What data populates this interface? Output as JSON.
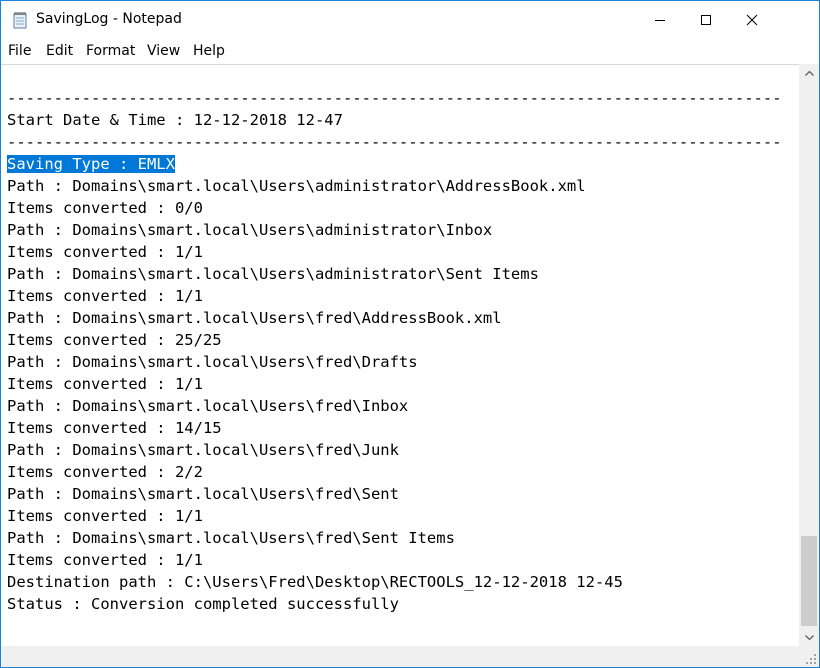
{
  "window": {
    "title": "SavingLog - Notepad",
    "icon": "notepad-icon"
  },
  "menu": {
    "file": "File",
    "edit": "Edit",
    "format": "Format",
    "view": "View",
    "help": "Help"
  },
  "document": {
    "lines": [
      "-----------------------------------------------------------------------------------",
      "Start Date & Time : 12-12-2018 12-47",
      "-----------------------------------------------------------------------------------",
      "Saving Type : EMLX",
      "Path : Domains\\smart.local\\Users\\administrator\\AddressBook.xml",
      "Items converted : 0/0",
      "Path : Domains\\smart.local\\Users\\administrator\\Inbox",
      "Items converted : 1/1",
      "Path : Domains\\smart.local\\Users\\administrator\\Sent Items",
      "Items converted : 1/1",
      "Path : Domains\\smart.local\\Users\\fred\\AddressBook.xml",
      "Items converted : 25/25",
      "Path : Domains\\smart.local\\Users\\fred\\Drafts",
      "Items converted : 1/1",
      "Path : Domains\\smart.local\\Users\\fred\\Inbox",
      "Items converted : 14/15",
      "Path : Domains\\smart.local\\Users\\fred\\Junk",
      "Items converted : 2/2",
      "Path : Domains\\smart.local\\Users\\fred\\Sent",
      "Items converted : 1/1",
      "Path : Domains\\smart.local\\Users\\fred\\Sent Items",
      "Items converted : 1/1",
      "Destination path : C:\\Users\\Fred\\Desktop\\RECTOOLS_12-12-2018 12-45",
      "Status : Conversion completed successfully"
    ],
    "selected_line": 3
  },
  "colors": {
    "selection": "#0078d7",
    "border": "#1883d7"
  }
}
